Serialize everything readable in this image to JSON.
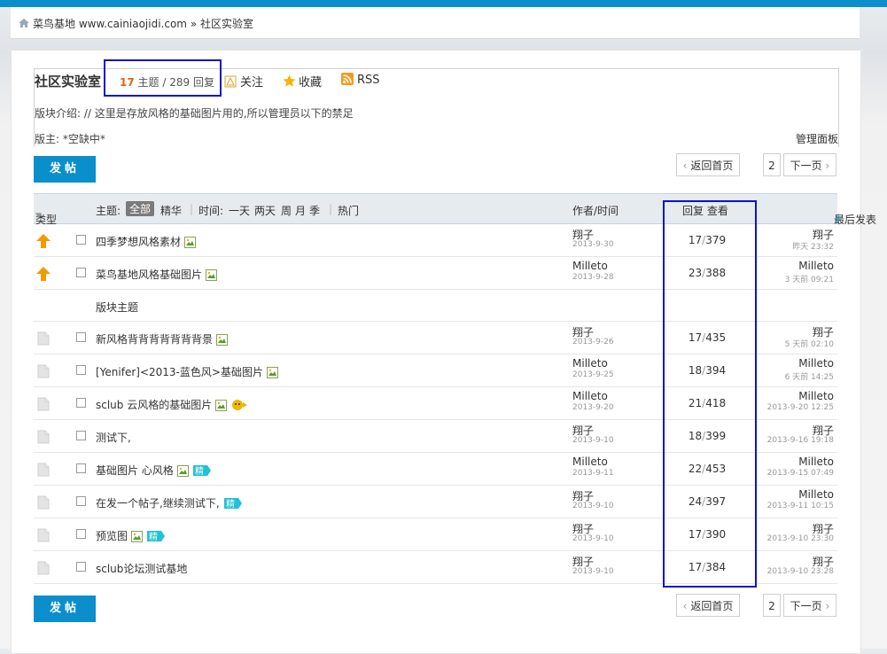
{
  "breadcrumb": {
    "site": "菜鸟基地",
    "url": "www.cainiaojidi.com",
    "sep": "»",
    "current": "社区实验室"
  },
  "forum": {
    "title": "社区实验室",
    "topics_count": "17",
    "topics_label": "主题",
    "replies_count": "289",
    "replies_label": "回复",
    "follow": "关注",
    "favorite": "收藏",
    "rss": "RSS",
    "description": "版块介绍: // 这里是存放风格的基础图片用的,所以管理员以下的禁足",
    "moderator": "版主: *空缺中*",
    "manage": "管理面板"
  },
  "actions": {
    "post": "发帖",
    "back_home": "返回首页",
    "page": "2",
    "next": "下一页"
  },
  "table_header": {
    "type": "类型",
    "topic": "主题:",
    "all": "全部",
    "digest": "精华",
    "time": "时间:",
    "day": "一天",
    "two_days": "两天",
    "week": "周",
    "month": "月",
    "quarter": "季",
    "hot": "热门",
    "author_time": "作者/时间",
    "reply_view": "回复 查看",
    "last_post": "最后发表"
  },
  "section_label": "版块主题",
  "sticky_rows": [
    {
      "title": "四季梦想风格素材",
      "author": "翔子",
      "date": "2013-9-30",
      "replies": "17",
      "views": "379",
      "last_user": "翔子",
      "last_time": "昨天 23:32",
      "img": true,
      "digest": false,
      "face": false
    },
    {
      "title": "菜鸟基地风格基础图片",
      "author": "Milleto",
      "date": "2013-9-28",
      "replies": "23",
      "views": "388",
      "last_user": "Milleto",
      "last_time": "3 天前 09:21",
      "img": true,
      "digest": false,
      "face": false
    }
  ],
  "rows": [
    {
      "title": "新风格背背背背背背背景",
      "author": "翔子",
      "date": "2013-9-26",
      "replies": "17",
      "views": "435",
      "last_user": "翔子",
      "last_time": "5 天前 02:10",
      "img": true,
      "digest": false,
      "face": false
    },
    {
      "title": "[Yenifer]<2013-蓝色风>基础图片",
      "author": "Milleto",
      "date": "2013-9-25",
      "replies": "18",
      "views": "394",
      "last_user": "Milleto",
      "last_time": "6 天前 14:25",
      "img": true,
      "digest": false,
      "face": false
    },
    {
      "title": "sclub 云风格的基础图片",
      "author": "Milleto",
      "date": "2013-9-20",
      "replies": "21",
      "views": "418",
      "last_user": "Milleto",
      "last_time": "2013-9-20 12:25",
      "img": true,
      "digest": false,
      "face": true
    },
    {
      "title": "测试下,",
      "author": "翔子",
      "date": "2013-9-10",
      "replies": "18",
      "views": "399",
      "last_user": "翔子",
      "last_time": "2013-9-16 19:18",
      "img": false,
      "digest": false,
      "face": false
    },
    {
      "title": "基础图片 心风格",
      "author": "Milleto",
      "date": "2013-9-11",
      "replies": "22",
      "views": "453",
      "last_user": "Milleto",
      "last_time": "2013-9-15 07:49",
      "img": true,
      "digest": true,
      "face": false
    },
    {
      "title": "在发一个帖子,继续测试下,",
      "author": "翔子",
      "date": "2013-9-10",
      "replies": "24",
      "views": "397",
      "last_user": "Milleto",
      "last_time": "2013-9-11 10:15",
      "img": false,
      "digest": true,
      "face": false
    },
    {
      "title": "预览图",
      "author": "翔子",
      "date": "2013-9-10",
      "replies": "17",
      "views": "390",
      "last_user": "翔子",
      "last_time": "2013-9-10 23:30",
      "img": true,
      "digest": true,
      "face": false
    },
    {
      "title": "sclub论坛测试基地",
      "author": "翔子",
      "date": "2013-9-10",
      "replies": "17",
      "views": "384",
      "last_user": "翔子",
      "last_time": "2013-9-10 23:28",
      "img": false,
      "digest": false,
      "face": false
    }
  ],
  "digest_badge": "精",
  "colors": {
    "accent": "#0a8fcc",
    "count": "#e7620f",
    "highlight_box": "#1010d0",
    "sticky_icon": "#f39a00"
  }
}
